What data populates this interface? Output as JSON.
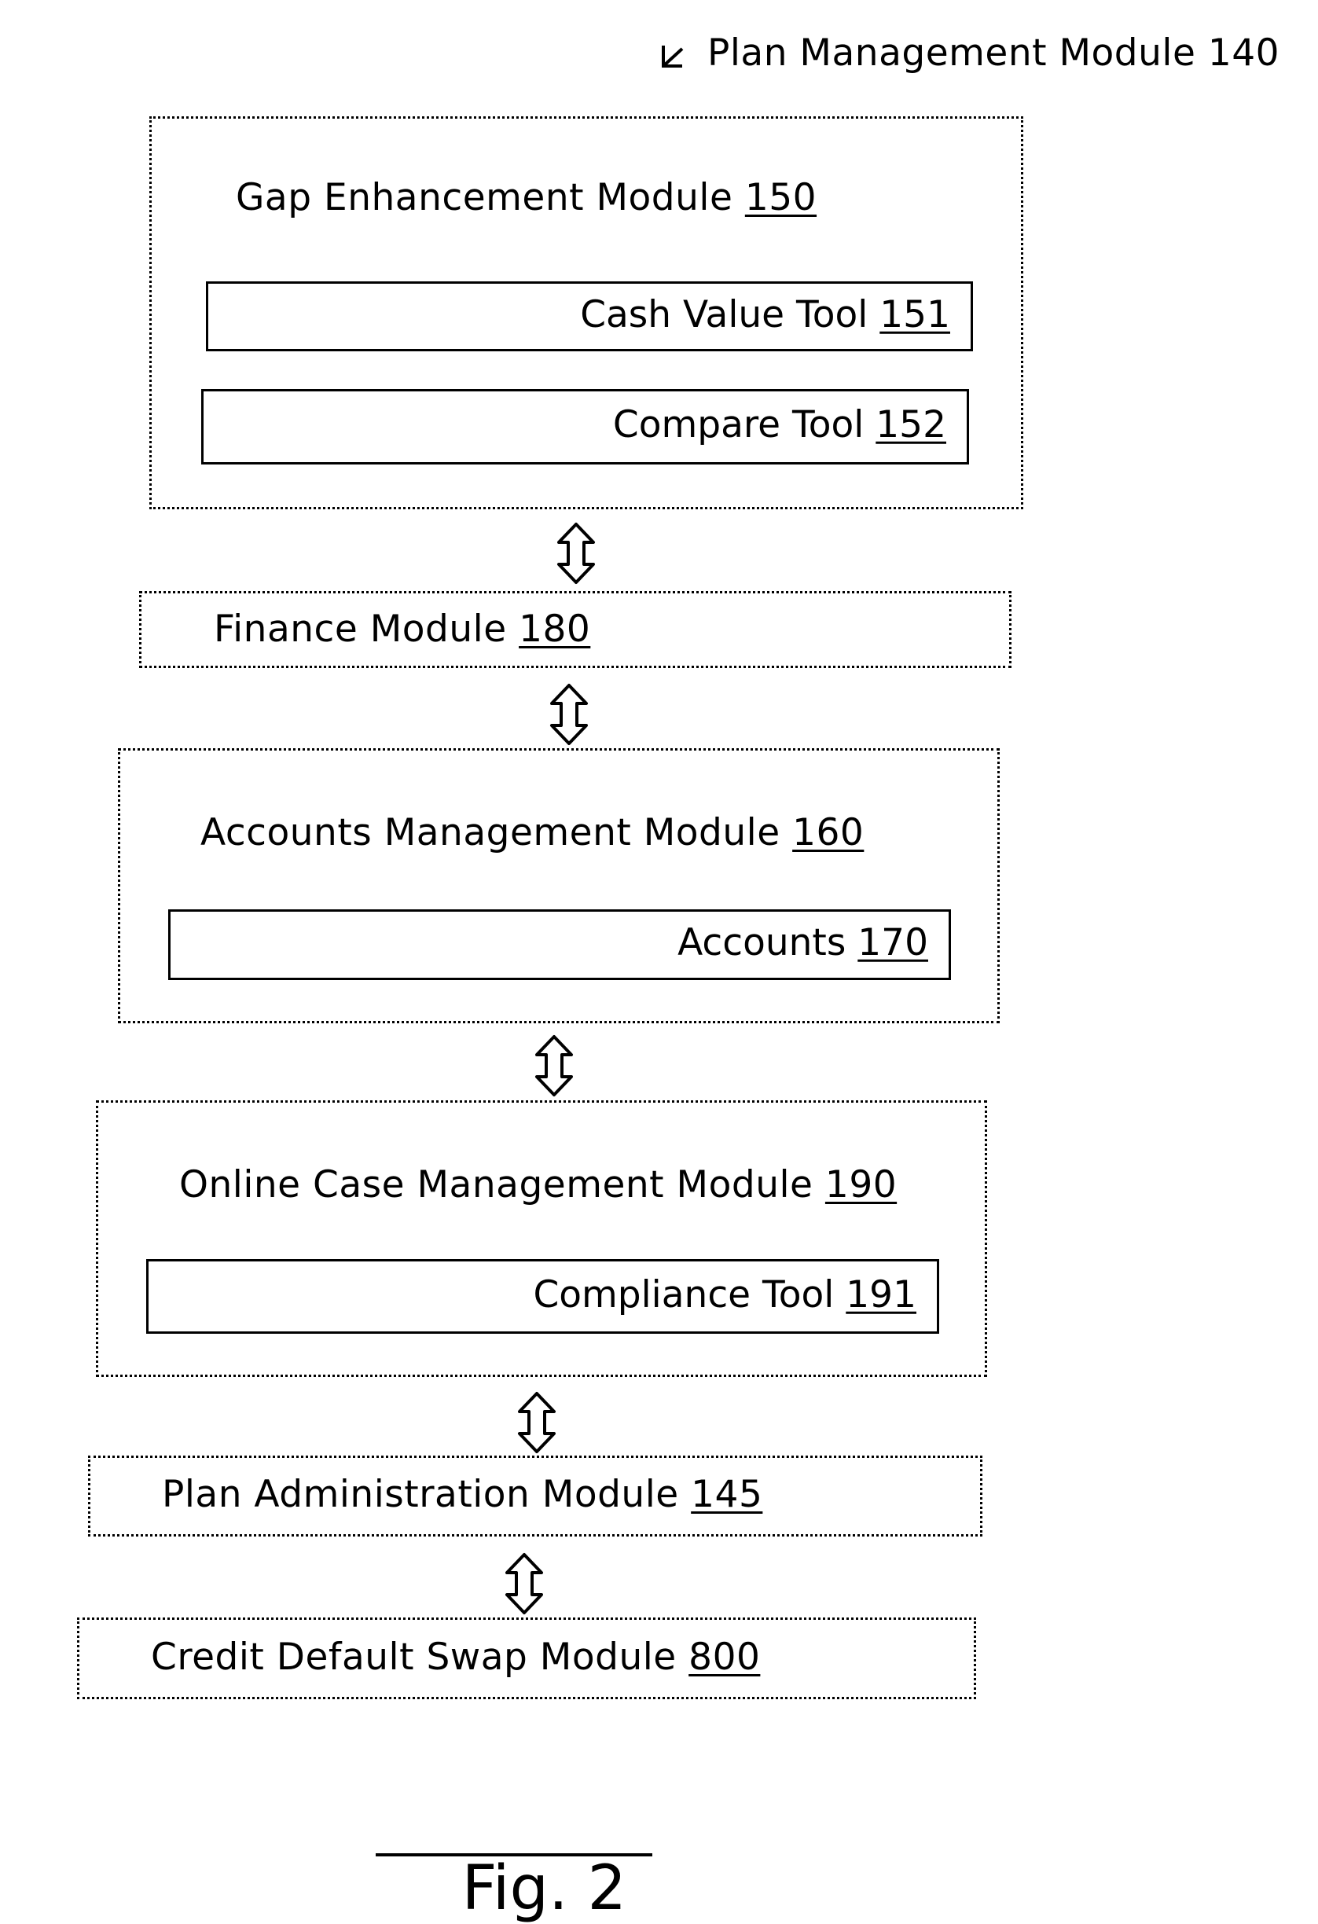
{
  "header": {
    "pointer_icon": "arrow-down-left-icon",
    "title": "Plan Management Module",
    "ref": "140"
  },
  "modules": {
    "gap_enhancement": {
      "title": "Gap Enhancement Module",
      "ref": "150",
      "tools": [
        {
          "label": "Cash Value Tool",
          "ref": "151"
        },
        {
          "label": "Compare Tool",
          "ref": "152"
        }
      ]
    },
    "finance": {
      "title": "Finance Module",
      "ref": "180"
    },
    "accounts_management": {
      "title": "Accounts Management Module",
      "ref": "160",
      "tools": [
        {
          "label": "Accounts",
          "ref": "170"
        }
      ]
    },
    "online_case_management": {
      "title": "Online Case Management Module",
      "ref": "190",
      "tools": [
        {
          "label": "Compliance Tool",
          "ref": "191"
        }
      ]
    },
    "plan_administration": {
      "title": "Plan Administration Module",
      "ref": "145"
    },
    "credit_default_swap": {
      "title": "Credit Default Swap Module",
      "ref": "800"
    }
  },
  "connectors": [
    {
      "from": "Gap Enhancement Module 150",
      "to": "Finance Module 180",
      "type": "bidirectional"
    },
    {
      "from": "Finance Module 180",
      "to": "Accounts Management Module 160",
      "type": "bidirectional"
    },
    {
      "from": "Accounts Management Module 160",
      "to": "Online Case Management Module 190",
      "type": "bidirectional"
    },
    {
      "from": "Online Case Management Module 190",
      "to": "Plan Administration Module 145",
      "type": "bidirectional"
    },
    {
      "from": "Plan Administration Module 145",
      "to": "Credit Default Swap Module 800",
      "type": "bidirectional"
    }
  ],
  "figure": {
    "caption": "Fig. 2"
  }
}
